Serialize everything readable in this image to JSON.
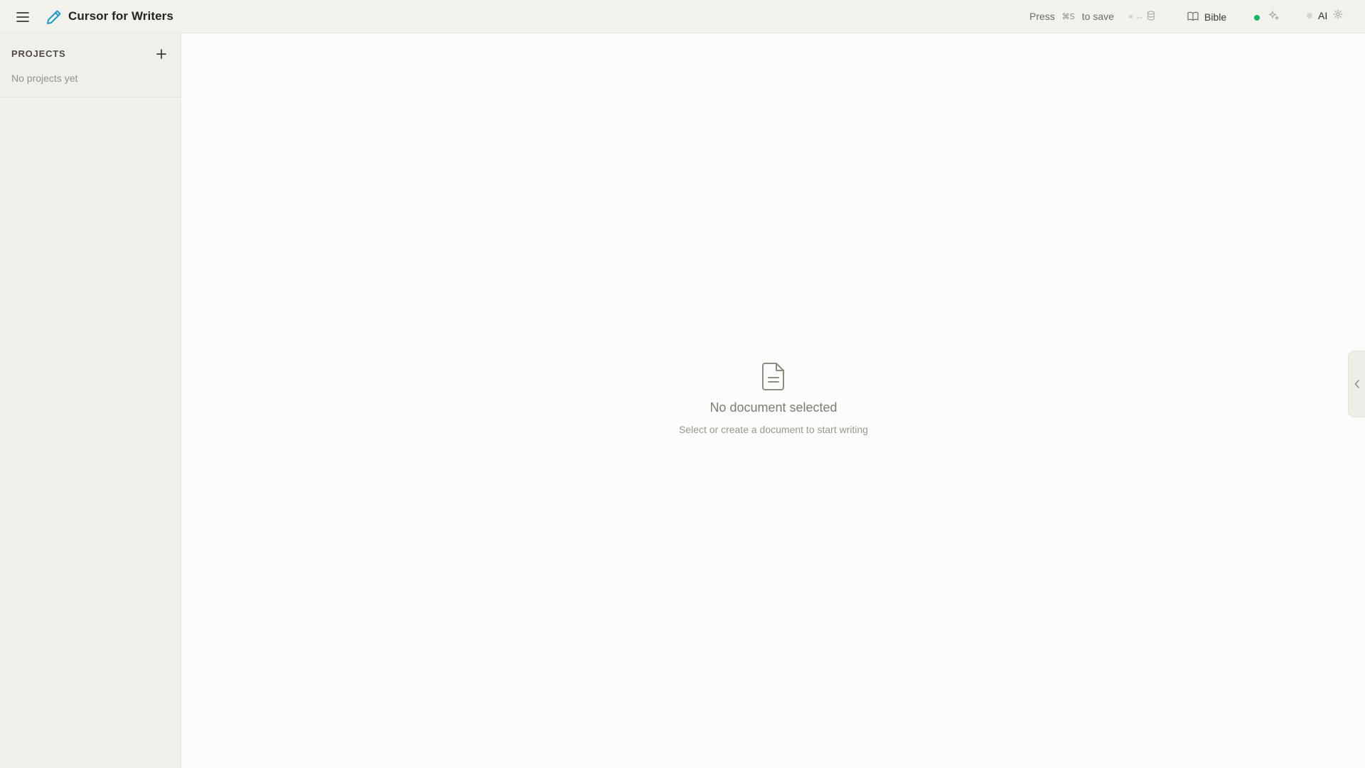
{
  "app": {
    "title": "Cursor for Writers",
    "accent_color": "#1d9bd1"
  },
  "toolbar": {
    "save_prefix": "Press",
    "save_shortcut": "⌘S",
    "save_suffix": "to save",
    "sync_text": "--",
    "bible_label": "Bible",
    "ai_label": "AI",
    "status_green": "#18b56a"
  },
  "sidebar": {
    "projects_title": "PROJECTS",
    "empty_text": "No projects yet"
  },
  "main": {
    "empty_title": "No document selected",
    "empty_subtitle": "Select or create a document to start writing"
  }
}
